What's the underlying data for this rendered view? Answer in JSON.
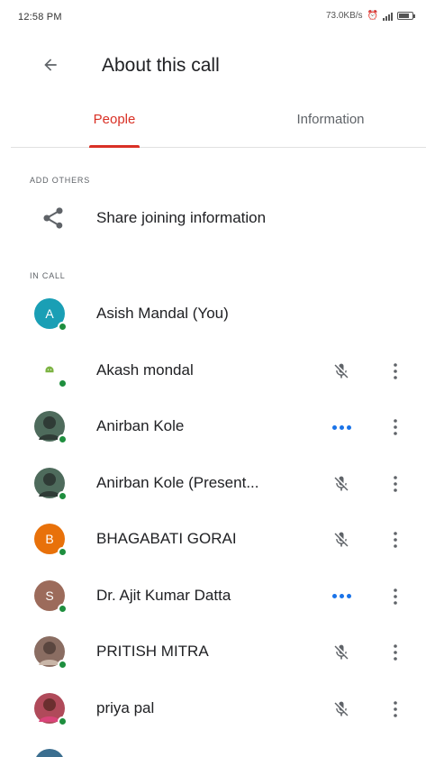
{
  "status_bar": {
    "time": "12:58 PM",
    "net_speed": "73.0KB/s",
    "icons": [
      "alarm-icon",
      "signal-icon",
      "battery-icon"
    ]
  },
  "header": {
    "title": "About this call",
    "back_icon": "arrow-back-icon"
  },
  "tabs": [
    {
      "label": "People",
      "active": true
    },
    {
      "label": "Information",
      "active": false
    }
  ],
  "add_others": {
    "section_label": "ADD OTHERS",
    "share_label": "Share joining information",
    "share_icon": "share-icon"
  },
  "in_call": {
    "section_label": "IN CALL",
    "participants": [
      {
        "name": "Asish Mandal (You)",
        "initial": "A",
        "avatar_color": "#1a9fb5",
        "status": "self"
      },
      {
        "name": "Akash mondal",
        "initial": "",
        "avatar_color": "#ffffff",
        "status": "muted"
      },
      {
        "name": "Anirban Kole",
        "initial": "",
        "avatar_color": "#4e6b5c",
        "status": "speaking"
      },
      {
        "name": "Anirban Kole (Present...",
        "initial": "",
        "avatar_color": "#4e6b5c",
        "status": "muted"
      },
      {
        "name": "BHAGABATI GORAI",
        "initial": "B",
        "avatar_color": "#e8710a",
        "status": "muted"
      },
      {
        "name": "Dr. Ajit Kumar Datta",
        "initial": "S",
        "avatar_color": "#9c6b5b",
        "status": "speaking"
      },
      {
        "name": "PRITISH MITRA",
        "initial": "",
        "avatar_color": "#8a6d62",
        "status": "muted"
      },
      {
        "name": "priya pal",
        "initial": "",
        "avatar_color": "#b04a5a",
        "status": "muted"
      },
      {
        "name": "",
        "initial": "",
        "avatar_color": "#3b6e8f",
        "status": "muted"
      }
    ]
  },
  "colors": {
    "accent": "#d93025",
    "online": "#1e8e3e",
    "speaking": "#1a73e8",
    "icon_grey": "#5f6368"
  }
}
